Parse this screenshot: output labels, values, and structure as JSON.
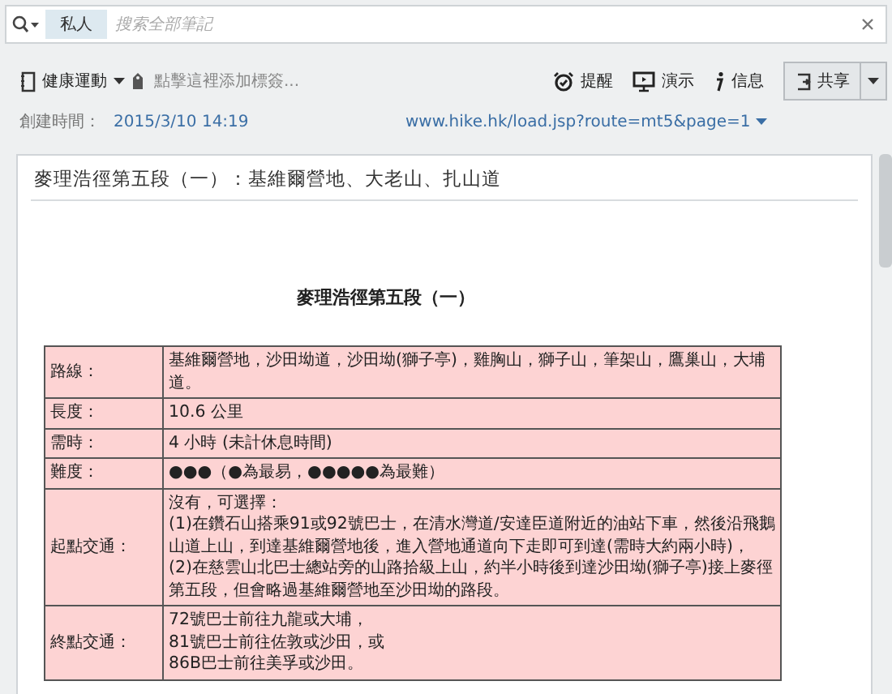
{
  "search": {
    "scope": "私人",
    "placeholder": "搜索全部筆記"
  },
  "toolbar": {
    "notebook": "健康運動",
    "tag_placeholder": "點擊這裡添加標簽...",
    "actions": [
      {
        "kind": "alarm",
        "label": "提醒"
      },
      {
        "kind": "present",
        "label": "演示"
      },
      {
        "kind": "info",
        "label": "信息"
      }
    ],
    "share": "共享"
  },
  "meta": {
    "created_label": "創建時間：",
    "created": "2015/3/10 14:19",
    "url": "www.hike.hk/load.jsp?route=mt5&page=1"
  },
  "note": {
    "title": "麥理浩徑第五段（一）：基維爾營地、大老山、扎山道",
    "heading": "麥理浩徑第五段（一）",
    "table": {
      "rows": [
        {
          "label": "路線：",
          "lines": [
            "基維爾營地，沙田坳道，沙田坳(獅子亭)，雞胸山，獅子山，筆架山，鷹巢山，大埔",
            "道。"
          ]
        },
        {
          "label": "長度：",
          "lines": [
            "10.6 公里"
          ]
        },
        {
          "label": "需時：",
          "lines": [
            "4 小時 (未計休息時間)"
          ]
        },
        {
          "label": "難度：",
          "lines": [
            "●●●（●為最易，●●●●●為最難）"
          ]
        },
        {
          "label": "起點交通：",
          "lines": [
            "沒有，可選擇：",
            "(1)在鑽石山搭乘91或92號巴士，在清水灣道/安達臣道附近的油站下車，然後沿飛鵝",
            "山道上山，到達基維爾營地後，進入營地通道向下走即可到達(需時大約兩小時)，",
            "(2)在慈雲山北巴士總站旁的山路拾級上山，約半小時後到達沙田坳(獅子亭)接上麥徑",
            "第五段，但會略過基維爾營地至沙田坳的路段。"
          ]
        },
        {
          "label": "終點交通：",
          "lines": [
            "72號巴士前往九龍或大埔，",
            "81號巴士前往佐敦或沙田，或",
            "86B巴士前往美孚或沙田。"
          ]
        }
      ]
    }
  }
}
